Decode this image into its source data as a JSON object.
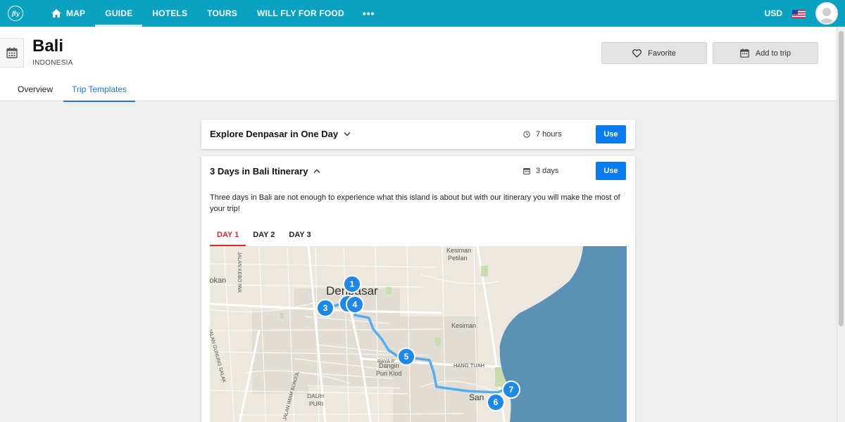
{
  "nav": {
    "items": [
      {
        "label": "MAP",
        "active": false
      },
      {
        "label": "GUIDE",
        "active": true
      },
      {
        "label": "HOTELS",
        "active": false
      },
      {
        "label": "TOURS",
        "active": false
      },
      {
        "label": "WILL FLY FOR FOOD",
        "active": false
      }
    ],
    "more": "•••",
    "currency": "USD"
  },
  "header": {
    "title": "Bali",
    "subtitle": "INDONESIA",
    "favorite_label": "Favorite",
    "add_to_trip_label": "Add to trip",
    "tabs": [
      {
        "label": "Overview",
        "active": false
      },
      {
        "label": "Trip Templates",
        "active": true
      }
    ]
  },
  "cards": [
    {
      "title": "Explore Denpasar in One Day",
      "meta": "7 hours",
      "use_label": "Use",
      "expanded": false
    },
    {
      "title": "3 Days in Bali Itinerary",
      "meta": "3 days",
      "use_label": "Use",
      "expanded": true,
      "description": "Three days in Bali are not enough to experience what this island is about but with our itinerary you will make the most of your trip!",
      "day_tabs": [
        {
          "label": "DAY 1",
          "active": true
        },
        {
          "label": "DAY 2",
          "active": false
        },
        {
          "label": "DAY 3",
          "active": false
        }
      ]
    }
  ],
  "map": {
    "places": [
      "Denpasar",
      "Kesiman Petilan",
      "Kesiman",
      "Dangin Puri Klod",
      "DAUH PURI",
      "Pokan",
      "San"
    ],
    "roads": [
      "JALAN KEBO IWA",
      "JALAN GUNUNG SALAK",
      "JALAN IMAM BONJOL",
      "RAYA P",
      "HANG TUAH"
    ],
    "markers": [
      "1",
      "2",
      "3",
      "4",
      "5",
      "6",
      "7"
    ]
  },
  "colors": {
    "nav_bg": "#0aa2c0",
    "accent_blue": "#0a7cf0",
    "day_active": "#e0262e",
    "sea": "#5b91b5",
    "route": "#55adf0"
  }
}
